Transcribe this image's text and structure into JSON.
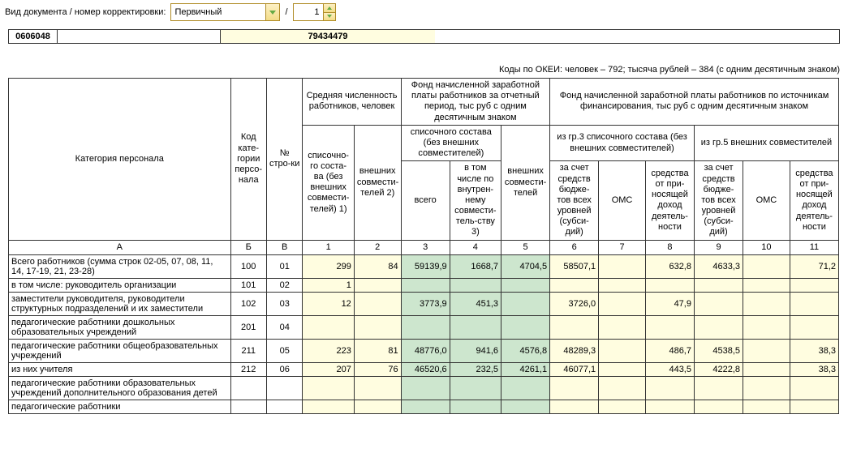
{
  "toolbar": {
    "label": "Вид документа / номер корректировки:",
    "doc_type": "Первичный",
    "slash": "/",
    "corr_no": "1"
  },
  "top_row": {
    "c1": "0606048",
    "c2": "",
    "c3": "79434479"
  },
  "okei": "Коды по ОКЕИ: человек – 792; тысяча рублей – 384 (с одним десятичным знаком)",
  "head": {
    "cat": "Категория персонала",
    "code": "Код кате-гории персо-нала",
    "row": "№ стро-ки",
    "mid": "Средняя численность работников, человек",
    "fund_period": "Фонд начисленной заработной платы работников за отчетный период, тыс руб\nс одним десятичным знаком",
    "fund_source": "Фонд начисленной заработной платы работников по источникам финансирования, тыс руб с одним десятичным знаком",
    "c1": "списочно-го соста-ва (без внешних совмести-телей) 1)",
    "c2": "внешних совмести-телей 2)",
    "list_no_ext": "списочного состава\n(без внешних совместителей)",
    "ext_part": "внешних совмести-телей",
    "from3": "из гр.3 списочного состава (без внешних совместителей)",
    "from5": "из гр.5 внешних совместителей",
    "c3": "всего",
    "c4": "в том числе по внутрен-нему совмести-тель-ству 3)",
    "sub": "за счет средств бюдже-тов всех уровней (субси-дий)",
    "oms": "ОМС",
    "inc": "средства от при-носящей доход деятель-ности",
    "colnum": {
      "A": "А",
      "B": "Б",
      "V": "В",
      "1": "1",
      "2": "2",
      "3": "3",
      "4": "4",
      "5": "5",
      "6": "6",
      "7": "7",
      "8": "8",
      "9": "9",
      "10": "10",
      "11": "11"
    }
  },
  "rows": [
    {
      "name": "Всего работников (сумма строк 02-05, 07, 08, 11, 14, 17-19, 21, 23-28)",
      "ind": 0,
      "code": "100",
      "row": "01",
      "v": {
        "1": "299",
        "2": "84",
        "3": "59139,9",
        "4": "1668,7",
        "5": "4704,5",
        "6": "58507,1",
        "7": "",
        "8": "632,8",
        "9": "4633,3",
        "10": "",
        "11": "71,2"
      }
    },
    {
      "name": "в том числе:\nруководитель организации",
      "ind": 1,
      "code": "101",
      "row": "02",
      "v": {
        "1": "1",
        "2": "",
        "3": "",
        "4": "",
        "5": "",
        "6": "",
        "7": "",
        "8": "",
        "9": "",
        "10": "",
        "11": ""
      }
    },
    {
      "name": "заместители руководителя, руководители структурных подразделений и их заместители",
      "ind": 1,
      "code": "102",
      "row": "03",
      "v": {
        "1": "12",
        "2": "",
        "3": "3773,9",
        "4": "451,3",
        "5": "",
        "6": "3726,0",
        "7": "",
        "8": "47,9",
        "9": "",
        "10": "",
        "11": ""
      }
    },
    {
      "name": "педагогические работники дошкольных образовательных учреждений",
      "ind": 1,
      "code": "201",
      "row": "04",
      "v": {
        "1": "",
        "2": "",
        "3": "",
        "4": "",
        "5": "",
        "6": "",
        "7": "",
        "8": "",
        "9": "",
        "10": "",
        "11": ""
      }
    },
    {
      "name": "педагогические работники общеобразовательных  учреждений",
      "ind": 1,
      "code": "211",
      "row": "05",
      "v": {
        "1": "223",
        "2": "81",
        "3": "48776,0",
        "4": "941,6",
        "5": "4576,8",
        "6": "48289,3",
        "7": "",
        "8": "486,7",
        "9": "4538,5",
        "10": "",
        "11": "38,3"
      }
    },
    {
      "name": "из них учителя",
      "ind": 2,
      "code": "212",
      "row": "06",
      "v": {
        "1": "207",
        "2": "76",
        "3": "46520,6",
        "4": "232,5",
        "5": "4261,1",
        "6": "46077,1",
        "7": "",
        "8": "443,5",
        "9": "4222,8",
        "10": "",
        "11": "38,3"
      }
    },
    {
      "name": "педагогические работники образовательных учреждений дополнительного образования детей",
      "ind": 1,
      "code": "",
      "row": "",
      "v": {
        "1": "",
        "2": "",
        "3": "",
        "4": "",
        "5": "",
        "6": "",
        "7": "",
        "8": "",
        "9": "",
        "10": "",
        "11": ""
      }
    },
    {
      "name": "педагогические работники",
      "ind": 1,
      "code": "",
      "row": "",
      "v": {
        "1": "",
        "2": "",
        "3": "",
        "4": "",
        "5": "",
        "6": "",
        "7": "",
        "8": "",
        "9": "",
        "10": "",
        "11": ""
      }
    }
  ],
  "cell_colors": {
    "default": "y",
    "green_cols": [
      "3",
      "4",
      "5"
    ]
  }
}
